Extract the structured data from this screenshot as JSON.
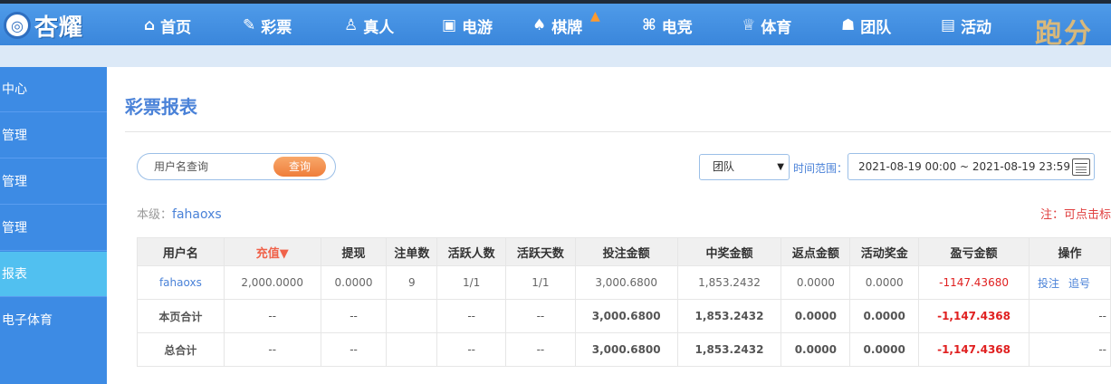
{
  "brand": {
    "name": "杏耀"
  },
  "nav": [
    {
      "label": "首页",
      "icon": "home-icon"
    },
    {
      "label": "彩票",
      "icon": "lottery-ticket-icon"
    },
    {
      "label": "真人",
      "icon": "live-dealer-icon"
    },
    {
      "label": "电游",
      "icon": "slot-machine-icon"
    },
    {
      "label": "棋牌",
      "icon": "card-game-icon"
    },
    {
      "label": "电竞",
      "icon": "gamepad-icon"
    },
    {
      "label": "体育",
      "icon": "trophy-icon"
    },
    {
      "label": "团队",
      "icon": "team-icon"
    },
    {
      "label": "活动",
      "icon": "gift-icon"
    }
  ],
  "nav_decoration": "跑分",
  "sidebar": [
    {
      "label": "中心"
    },
    {
      "label": "管理"
    },
    {
      "label": "管理"
    },
    {
      "label": "管理"
    },
    {
      "label": "报表"
    },
    {
      "label": "电子体育"
    }
  ],
  "page_title": "彩票报表",
  "search": {
    "placeholder": "用户名查询",
    "button": "查询"
  },
  "filter": {
    "selected": "团队",
    "range_label": "时间范围：",
    "date_range": "2021-08-19 00:00 ~ 2021-08-19 23:59"
  },
  "level": {
    "label": "本级：",
    "user": "fahaoxs"
  },
  "note": "注：可点击标",
  "table": {
    "headers": [
      "用户名",
      "充值▼",
      "提现",
      "注单数",
      "活跃人数",
      "活跃天数",
      "投注金额",
      "中奖金额",
      "返点金额",
      "活动奖金",
      "盈亏金额",
      "操作"
    ],
    "rows": [
      {
        "user": "fahaoxs",
        "recharge": "2,000.0000",
        "withdraw": "0.0000",
        "orders": "9",
        "active_users": "1/1",
        "active_days": "1/1",
        "bet": "3,000.6800",
        "win": "1,853.2432",
        "rebate": "0.0000",
        "bonus": "0.0000",
        "profit": "-1147.43680",
        "ops": [
          "投注",
          "追号"
        ]
      }
    ],
    "page_total": {
      "label": "本页合计",
      "recharge": "--",
      "withdraw": "--",
      "orders": "",
      "active_users": "--",
      "active_days": "--",
      "bet": "3,000.6800",
      "win": "1,853.2432",
      "rebate": "0.0000",
      "bonus": "0.0000",
      "profit": "-1,147.4368",
      "ops": "--"
    },
    "grand_total": {
      "label": "总合计",
      "recharge": "--",
      "withdraw": "--",
      "orders": "",
      "active_users": "--",
      "active_days": "--",
      "bet": "3,000.6800",
      "win": "1,853.2432",
      "rebate": "0.0000",
      "bonus": "0.0000",
      "profit": "-1,147.4368",
      "ops": "--"
    }
  },
  "colors": {
    "nav_blue": "#3a86db",
    "sidebar_blue": "#3d8be4",
    "sidebar_active": "#51c0f0",
    "accent_orange": "#ef7d3b",
    "negative_red": "#e02020",
    "link_blue": "#4a82d8"
  }
}
